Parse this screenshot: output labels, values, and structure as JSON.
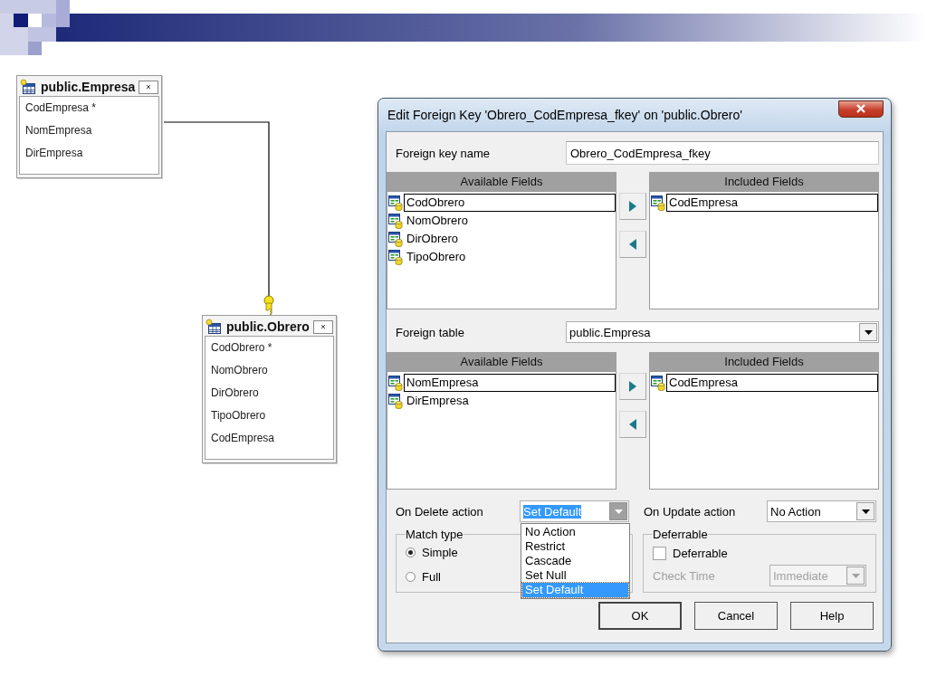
{
  "diagram": {
    "tables": [
      {
        "title": "public.Empresa",
        "fields": [
          "CodEmpresa *",
          "NomEmpresa",
          "DirEmpresa"
        ]
      },
      {
        "title": "public.Obrero",
        "fields": [
          "CodObrero *",
          "NomObrero",
          "DirObrero",
          "TipoObrero",
          "CodEmpresa"
        ]
      }
    ]
  },
  "dialog": {
    "title": "Edit Foreign Key 'Obrero_CodEmpresa_fkey' on 'public.Obrero'",
    "foreign_key_name": {
      "label": "Foreign key name",
      "value": "Obrero_CodEmpresa_fkey"
    },
    "key_fields": {
      "available": {
        "header": "Available Fields",
        "items": [
          {
            "label": "CodObrero",
            "selected": true
          },
          {
            "label": "NomObrero",
            "selected": false
          },
          {
            "label": "DirObrero",
            "selected": false
          },
          {
            "label": "TipoObrero",
            "selected": false
          }
        ]
      },
      "included": {
        "header": "Included Fields",
        "items": [
          {
            "label": "CodEmpresa",
            "selected": true
          }
        ]
      }
    },
    "foreign_table": {
      "label": "Foreign table",
      "value": "public.Empresa"
    },
    "reference_fields": {
      "available": {
        "header": "Available Fields",
        "items": [
          {
            "label": "NomEmpresa",
            "selected": true
          },
          {
            "label": "DirEmpresa",
            "selected": false
          }
        ]
      },
      "included": {
        "header": "Included Fields",
        "items": [
          {
            "label": "CodEmpresa",
            "selected": true
          }
        ]
      }
    },
    "on_delete": {
      "label": "On Delete action",
      "value": "Set Default",
      "expanded": true,
      "options": [
        {
          "label": "No Action",
          "selected": false
        },
        {
          "label": "Restrict",
          "selected": false
        },
        {
          "label": "Cascade",
          "selected": false
        },
        {
          "label": "Set Null",
          "selected": false
        },
        {
          "label": "Set Default",
          "selected": true
        }
      ]
    },
    "on_update": {
      "label": "On Update action",
      "value": "No Action",
      "expanded": false
    },
    "match_type": {
      "legend": "Match type",
      "options": [
        {
          "label": "Simple",
          "selected": true
        },
        {
          "label": "Full",
          "selected": false
        }
      ]
    },
    "deferrable": {
      "legend": "Deferrable",
      "checkbox": {
        "label": "Deferrable",
        "checked": false
      },
      "check_time": {
        "label": "Check Time",
        "value": "Immediate",
        "disabled": true
      }
    },
    "buttons": [
      {
        "label": "OK",
        "default": true
      },
      {
        "label": "Cancel",
        "default": false
      },
      {
        "label": "Help",
        "default": false
      }
    ]
  }
}
